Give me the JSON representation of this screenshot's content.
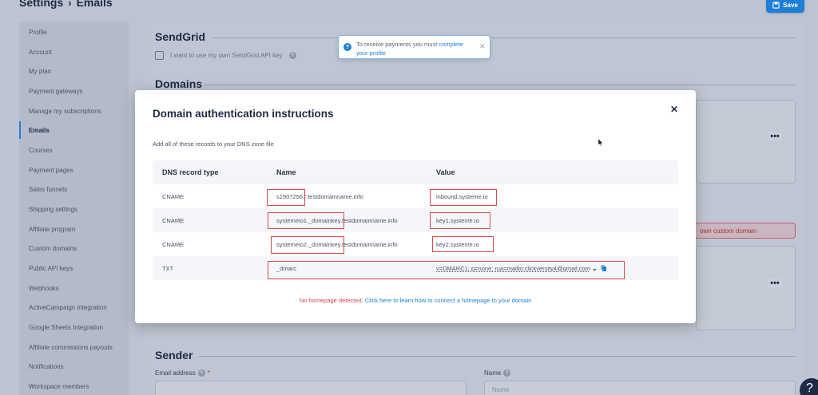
{
  "header": {
    "breadcrumb_root": "Settings",
    "breadcrumb_current": "Emails",
    "save_label": "Save"
  },
  "sidebar": {
    "items": [
      {
        "label": "Profile"
      },
      {
        "label": "Account"
      },
      {
        "label": "My plan"
      },
      {
        "label": "Payment gateways"
      },
      {
        "label": "Manage my subscriptions"
      },
      {
        "label": "Emails",
        "active": true
      },
      {
        "label": "Courses"
      },
      {
        "label": "Payment pages"
      },
      {
        "label": "Sales funnels"
      },
      {
        "label": "Shipping settings"
      },
      {
        "label": "Affiliate program"
      },
      {
        "label": "Custom domains"
      },
      {
        "label": "Public API keys"
      },
      {
        "label": "Webhooks"
      },
      {
        "label": "ActiveCampaign integration"
      },
      {
        "label": "Google Sheets Integration"
      },
      {
        "label": "Affiliate commissions payouts"
      },
      {
        "label": "Notifications"
      },
      {
        "label": "Workspace members"
      }
    ]
  },
  "sendgrid": {
    "title": "SendGrid",
    "checkbox_label": "I want to use my own SendGrid API key"
  },
  "domains": {
    "title": "Domains",
    "error_text": "own custom domain"
  },
  "sender": {
    "title": "Sender",
    "email_label": "Email address",
    "name_label": "Name",
    "name_placeholder": "Name"
  },
  "toast": {
    "text": "To receive payments you must",
    "link": "complete your profile"
  },
  "modal": {
    "title": "Domain authentication instructions",
    "subtitle": "Add all of these records to your DNS zone file",
    "columns": [
      "DNS record type",
      "Name",
      "Value"
    ],
    "rows": [
      {
        "type": "CNAME",
        "name": "s19072567.testdomainname.info",
        "value": "inbound.systeme.io"
      },
      {
        "type": "CNAME",
        "name": "systemeio1._domainkey.testdomainname.info",
        "value": "key1.systeme.io"
      },
      {
        "type": "CNAME",
        "name": "systemeio2._domainkey.testdomainname.info",
        "value": "key2.systeme.io"
      },
      {
        "type": "TXT",
        "name": "_dmarc",
        "value": "v=DMARC1; p=none; rua=mailto:clickversity4@gmail.com"
      }
    ],
    "footer_warning": "No homepage detected.",
    "footer_link": "Click here to learn how to connect a homepage to your domain"
  },
  "colors": {
    "accent": "#1e7fd6",
    "highlight": "#d84a4a",
    "warning": "#d64555"
  }
}
